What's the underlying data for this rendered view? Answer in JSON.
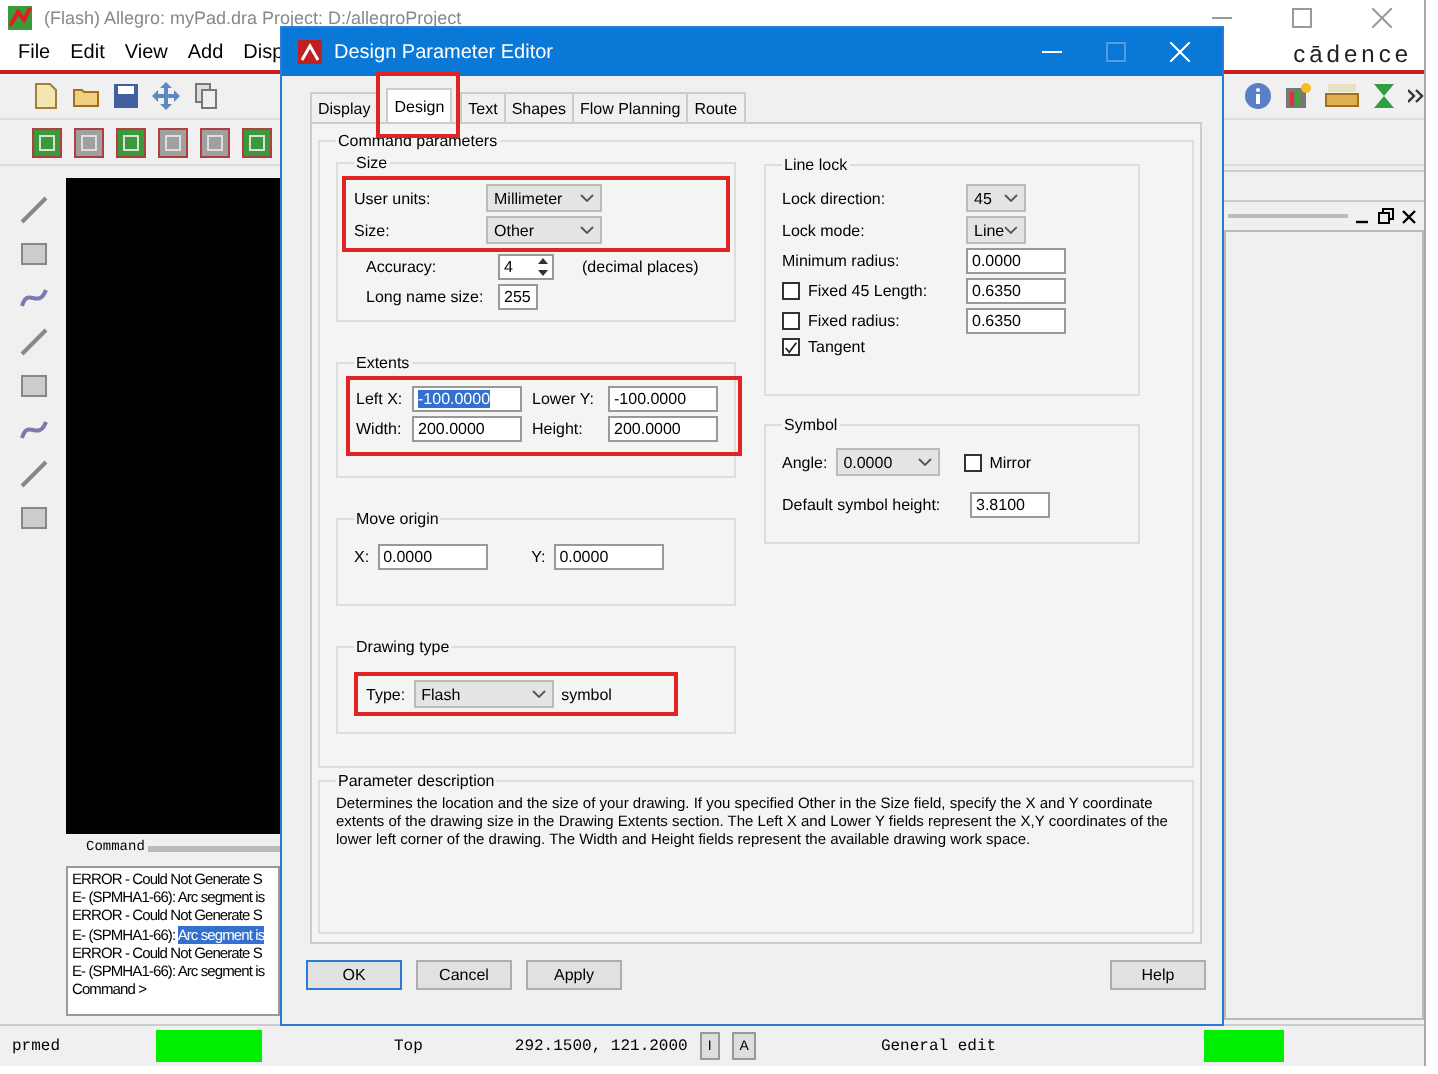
{
  "app_window": {
    "title": "(Flash) Allegro: myPad.dra  Project: D:/allegroProject",
    "menu": [
      "File",
      "Edit",
      "View",
      "Add",
      "Disp"
    ],
    "logo": "cādence",
    "command_label": "Command",
    "command_log": [
      {
        "text": "ERROR - Could Not Generate S"
      },
      {
        "text": "E- (SPMHA1-66): Arc segment is"
      },
      {
        "text": "ERROR - Could Not Generate S"
      },
      {
        "text": "E- (SPMHA1-66): ",
        "selected_text": "Arc segment is"
      },
      {
        "text": "ERROR - Could Not Generate S"
      },
      {
        "text": "E- (SPMHA1-66): Arc segment is"
      },
      {
        "text": "Command >"
      }
    ],
    "status_bar": {
      "mode": "prmed",
      "layer": "Top",
      "coordinates": "292.1500, 121.2000",
      "buttons": [
        "I",
        "A"
      ],
      "state": "General edit"
    }
  },
  "dialog": {
    "title": "Design Parameter Editor",
    "tabs": [
      {
        "label": "Display",
        "selected": false
      },
      {
        "label": "Design",
        "selected": true
      },
      {
        "label": "Text",
        "selected": false
      },
      {
        "label": "Shapes",
        "selected": false
      },
      {
        "label": "Flow Planning",
        "selected": false
      },
      {
        "label": "Route",
        "selected": false
      }
    ],
    "command_parameters": {
      "title": "Command parameters",
      "size": {
        "title": "Size",
        "user_units": {
          "label": "User units:",
          "value": "Millimeter"
        },
        "size": {
          "label": "Size:",
          "value": "Other"
        },
        "accuracy": {
          "label": "Accuracy:",
          "value": "4",
          "suffix": "(decimal places)"
        },
        "long_name_size": {
          "label": "Long name size:",
          "value": "255"
        }
      },
      "extents": {
        "title": "Extents",
        "fields": [
          {
            "label": "Left X:",
            "value": "-100.0000",
            "selected": true
          },
          {
            "label": "Lower Y:",
            "value": "-100.0000",
            "selected": false
          },
          {
            "label": "Width:",
            "value": "200.0000",
            "selected": false
          },
          {
            "label": "Height:",
            "value": "200.0000",
            "selected": false
          }
        ]
      },
      "move_origin": {
        "title": "Move origin",
        "x": {
          "label": "X:",
          "value": "0.0000"
        },
        "y": {
          "label": "Y:",
          "value": "0.0000"
        }
      },
      "drawing_type": {
        "title": "Drawing type",
        "type": {
          "label": "Type:",
          "value": "Flash"
        },
        "suffix": "symbol"
      },
      "line_lock": {
        "title": "Line lock",
        "lock_direction": {
          "label": "Lock direction:",
          "value": "45"
        },
        "lock_mode": {
          "label": "Lock mode:",
          "value": "Line"
        },
        "minimum_radius": {
          "label": "Minimum radius:",
          "value": "0.0000"
        },
        "fixed_45_length": {
          "label": "Fixed 45 Length:",
          "checked": false,
          "value": "0.6350"
        },
        "fixed_radius": {
          "label": "Fixed radius:",
          "checked": false,
          "value": "0.6350"
        },
        "tangent": {
          "label": "Tangent",
          "checked": true
        }
      },
      "symbol": {
        "title": "Symbol",
        "angle": {
          "label": "Angle:",
          "value": "0.0000"
        },
        "mirror": {
          "label": "Mirror",
          "checked": false
        },
        "default_symbol_height": {
          "label": "Default symbol height:",
          "value": "3.8100"
        }
      }
    },
    "parameter_description": {
      "title": "Parameter description",
      "text": "Determines the location and the size of your drawing. If you specified Other in the Size field, specify the X and Y coordinate extents of the drawing size in the Drawing Extents section. The Left X and Lower Y fields represent the X,Y coordinates of the lower left corner of the drawing. The Width and Height fields represent the available drawing work space."
    },
    "buttons": [
      "OK",
      "Cancel",
      "Apply",
      "Help"
    ]
  }
}
